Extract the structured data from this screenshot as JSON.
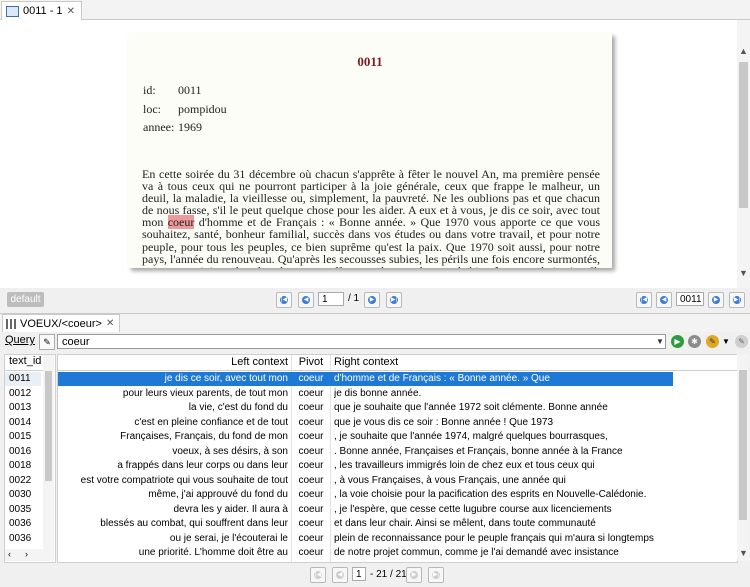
{
  "editor_tab": {
    "label": "0011 - 1"
  },
  "document": {
    "title": "0011",
    "meta": [
      {
        "key": "id:",
        "value": "0011"
      },
      {
        "key": "loc:",
        "value": "pompidou"
      },
      {
        "key": "annee:",
        "value": "1969"
      }
    ],
    "body_before": "En cette soirée du 31 décembre où chacun s'apprête à fêter le nouvel An, ma première pensée va à tous ceux qui ne pourront participer à la joie générale, ceux que frappe le malheur, un deuil, la maladie, la vieillesse ou, simplement, la pauvreté. Ne les oublions pas et que chacun de nous fasse, s'il le peut quelque chose pour les aider. A eux et à vous, je dis ce soir, avec tout mon ",
    "body_highlight": "coeur",
    "body_after": " d'homme et de Français : « Bonne année. » Que 1970 vous apporte ce que vous souhaitez, santé, bonheur familial, succès dans vos études ou dans votre travail, et pour notre peuple, pour tous les peuples, ce bien suprême qu'est la paix. Que 1970 soit aussi, pour notre pays, l'année du renouveau. Qu'après les secousses subies, les périls une fois encore surmontés, nous poursuivions dans le calme notre effort vers le progrès, vers le bien-être, vers la justice. Il"
  },
  "viewer_footer": {
    "default_label": "default",
    "page_current": "1",
    "page_total": "/ 1",
    "text_id_value": "0011"
  },
  "concordance": {
    "tab_label": "VOEUX/<coeur>",
    "query_label": "Query",
    "query_value": "coeur",
    "id_header": "text_id",
    "headers": {
      "left": "Left context",
      "pivot": "Pivot",
      "right": "Right context"
    },
    "rows": [
      {
        "id": "0011",
        "left": "je dis ce soir, avec tout mon",
        "pivot": "coeur",
        "right": "d'homme et de Français : « Bonne année. » Que"
      },
      {
        "id": "0012",
        "left": "pour leurs vieux parents, de tout mon",
        "pivot": "coeur",
        "right": "je dis bonne année."
      },
      {
        "id": "0013",
        "left": "la vie, c'est du fond du",
        "pivot": "coeur",
        "right": "que je souhaite que l'année 1972 soit clémente. Bonne année"
      },
      {
        "id": "0014",
        "left": "c'est en pleine confiance et de tout",
        "pivot": "coeur",
        "right": "que je vous dis ce soir : Bonne année ! Que 1973"
      },
      {
        "id": "0015",
        "left": "Françaises, Français, du fond de mon",
        "pivot": "coeur",
        "right": ", je souhaite que l'année 1974, malgré quelques bourrasques,"
      },
      {
        "id": "0016",
        "left": "voeux, à ses désirs, à son",
        "pivot": "coeur",
        "right": ". Bonne année, Françaises et Français, bonne année à la France"
      },
      {
        "id": "0018",
        "left": "a frappés dans leur corps ou dans leur",
        "pivot": "coeur",
        "right": ", les travailleurs immigrés loin de chez eux et tous ceux qui"
      },
      {
        "id": "0022",
        "left": "est votre compatriote qui vous souhaite de tout",
        "pivot": "coeur",
        "right": ", à vous Françaises, à vous Français, une année qui"
      },
      {
        "id": "0030",
        "left": "même, j'ai approuvé du fond du",
        "pivot": "coeur",
        "right": ", la voie choisie pour la pacification des esprits en Nouvelle-Calédonie."
      },
      {
        "id": "0035",
        "left": "devra les y aider. Il aura à",
        "pivot": "coeur",
        "right": ", je l'espère, que cesse cette lugubre course aux licenciements"
      },
      {
        "id": "0036",
        "left": "blessés au combat, qui souffrent dans leur",
        "pivot": "coeur",
        "right": "et dans leur chair. Ainsi se mêlent, dans toute communauté"
      },
      {
        "id": "0036",
        "left": "ou je serai, je l'écouterai le",
        "pivot": "coeur",
        "right": "plein de reconnaissance pour le peuple français qui m'aura si longtemps"
      },
      {
        "id": "0036",
        "left": "une priorité. L'homme doit être au",
        "pivot": "coeur",
        "right": "de notre projet commun, comme je l'ai demandé avec insistance"
      }
    ],
    "nav": {
      "current": "1",
      "range": "- 21 / 21"
    }
  }
}
